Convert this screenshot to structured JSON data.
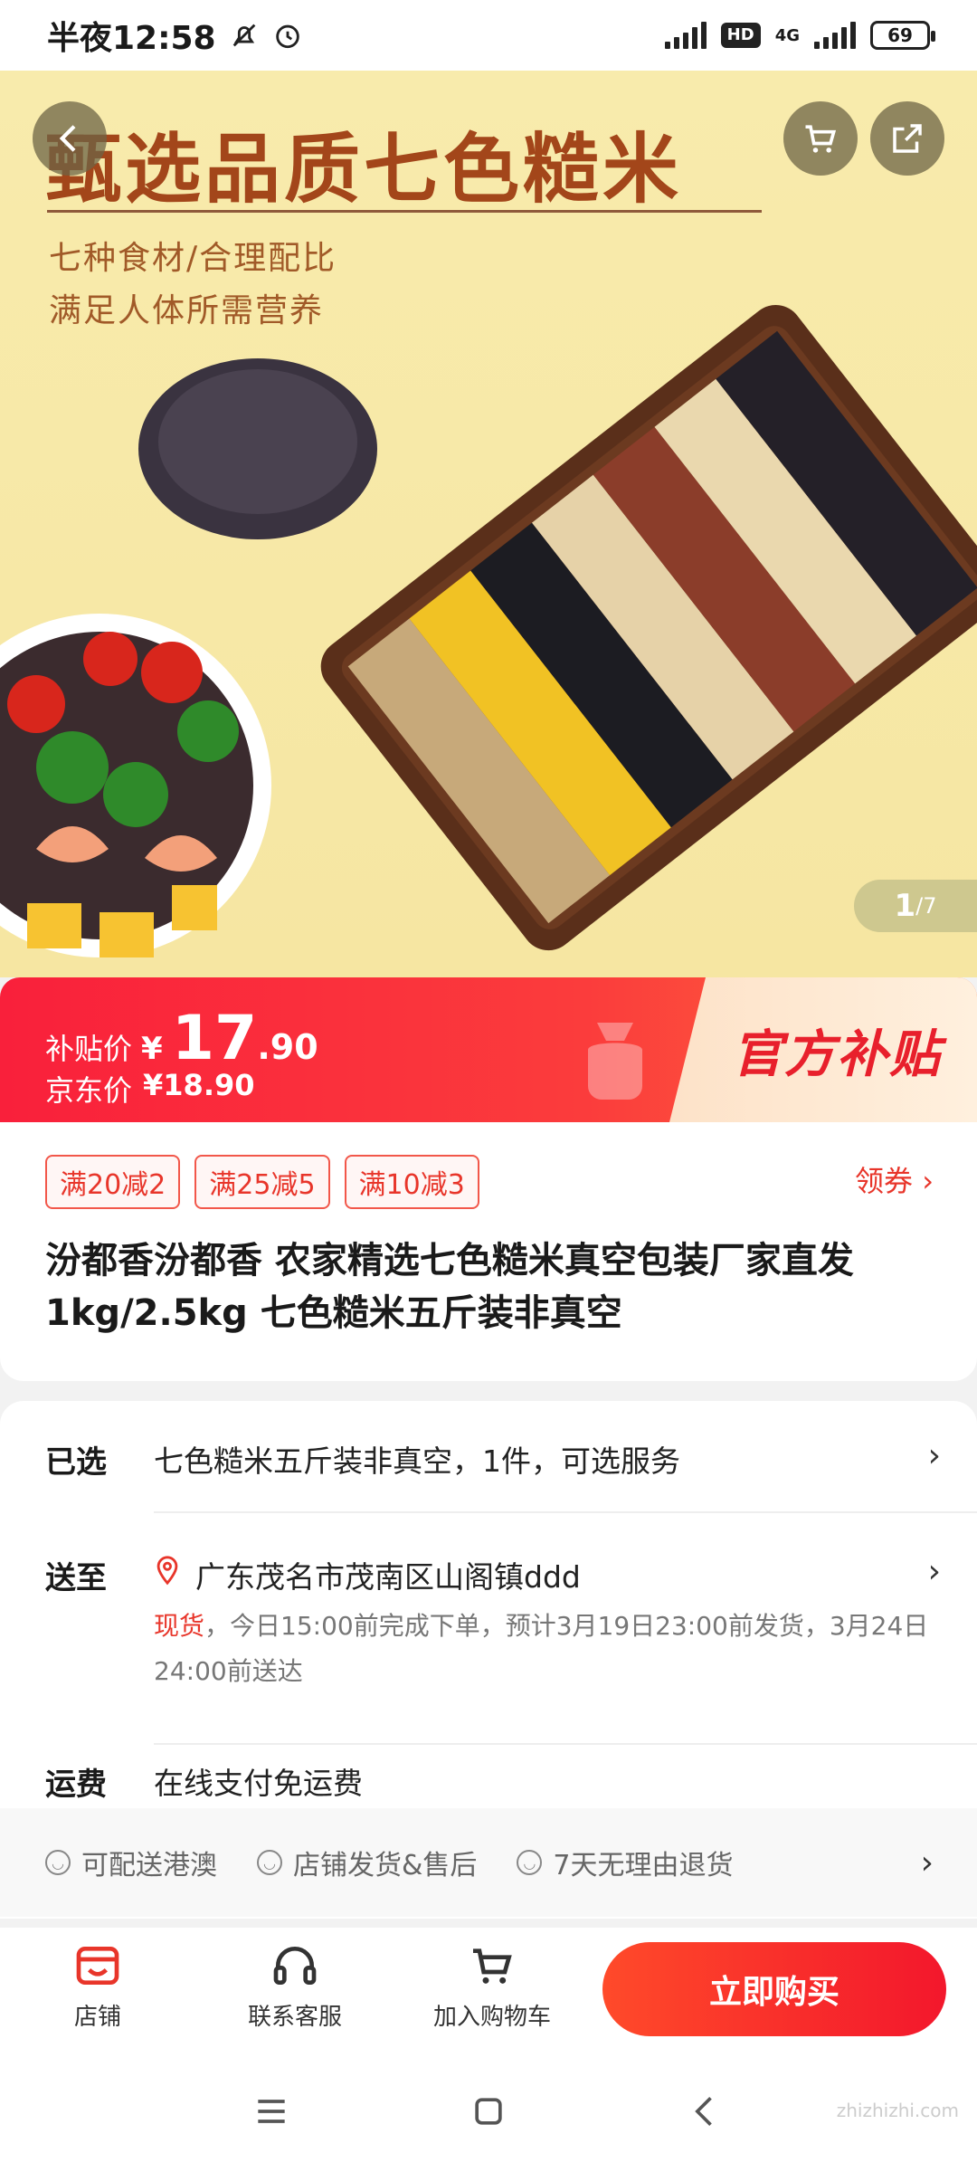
{
  "status_bar": {
    "time": "半夜12:58",
    "network": "4G",
    "hd": "HD",
    "battery": "69"
  },
  "hero": {
    "title": "甄选品质七色糙米",
    "sub1": "七种食材/合理配比",
    "sub2": "满足人体所需营养",
    "page_current": "1",
    "page_total": "/7"
  },
  "price": {
    "subsidy_label": "补贴价",
    "yen": "¥",
    "subsidy_int": "17",
    "subsidy_dec": ".90",
    "jd_label": "京东价",
    "jd_price": "¥18.90",
    "badge": "官方补贴"
  },
  "coupons": [
    "满20减2",
    "满25减5",
    "满10减3"
  ],
  "get_coupon": "领券 ›",
  "product_title": "汾都香汾都香 农家精选七色糙米真空包装厂家直发1kg/2.5kg 七色糙米五斤装非真空",
  "selected": {
    "label": "已选",
    "value": "七色糙米五斤装非真空，1件，可选服务"
  },
  "delivery": {
    "label": "送至",
    "address": "广东茂名市茂南区山阁镇ddd",
    "stock": "现货",
    "note": "，今日15:00前完成下单，预计3月19日23:00前发货，3月24日24:00前送达"
  },
  "shipping": {
    "label": "运费",
    "value": "在线支付免运费"
  },
  "services": [
    "可配送港澳",
    "店铺发货&售后",
    "7天无理由退货"
  ],
  "actions": {
    "store": "店铺",
    "service": "联系客服",
    "cart": "加入购物车",
    "buy": "立即购买"
  },
  "watermark": "zhizhizhi.com",
  "colors": {
    "accent_red": "#f3172c",
    "coupon_red": "#e8352a",
    "hero_bg": "#f8ebac"
  }
}
